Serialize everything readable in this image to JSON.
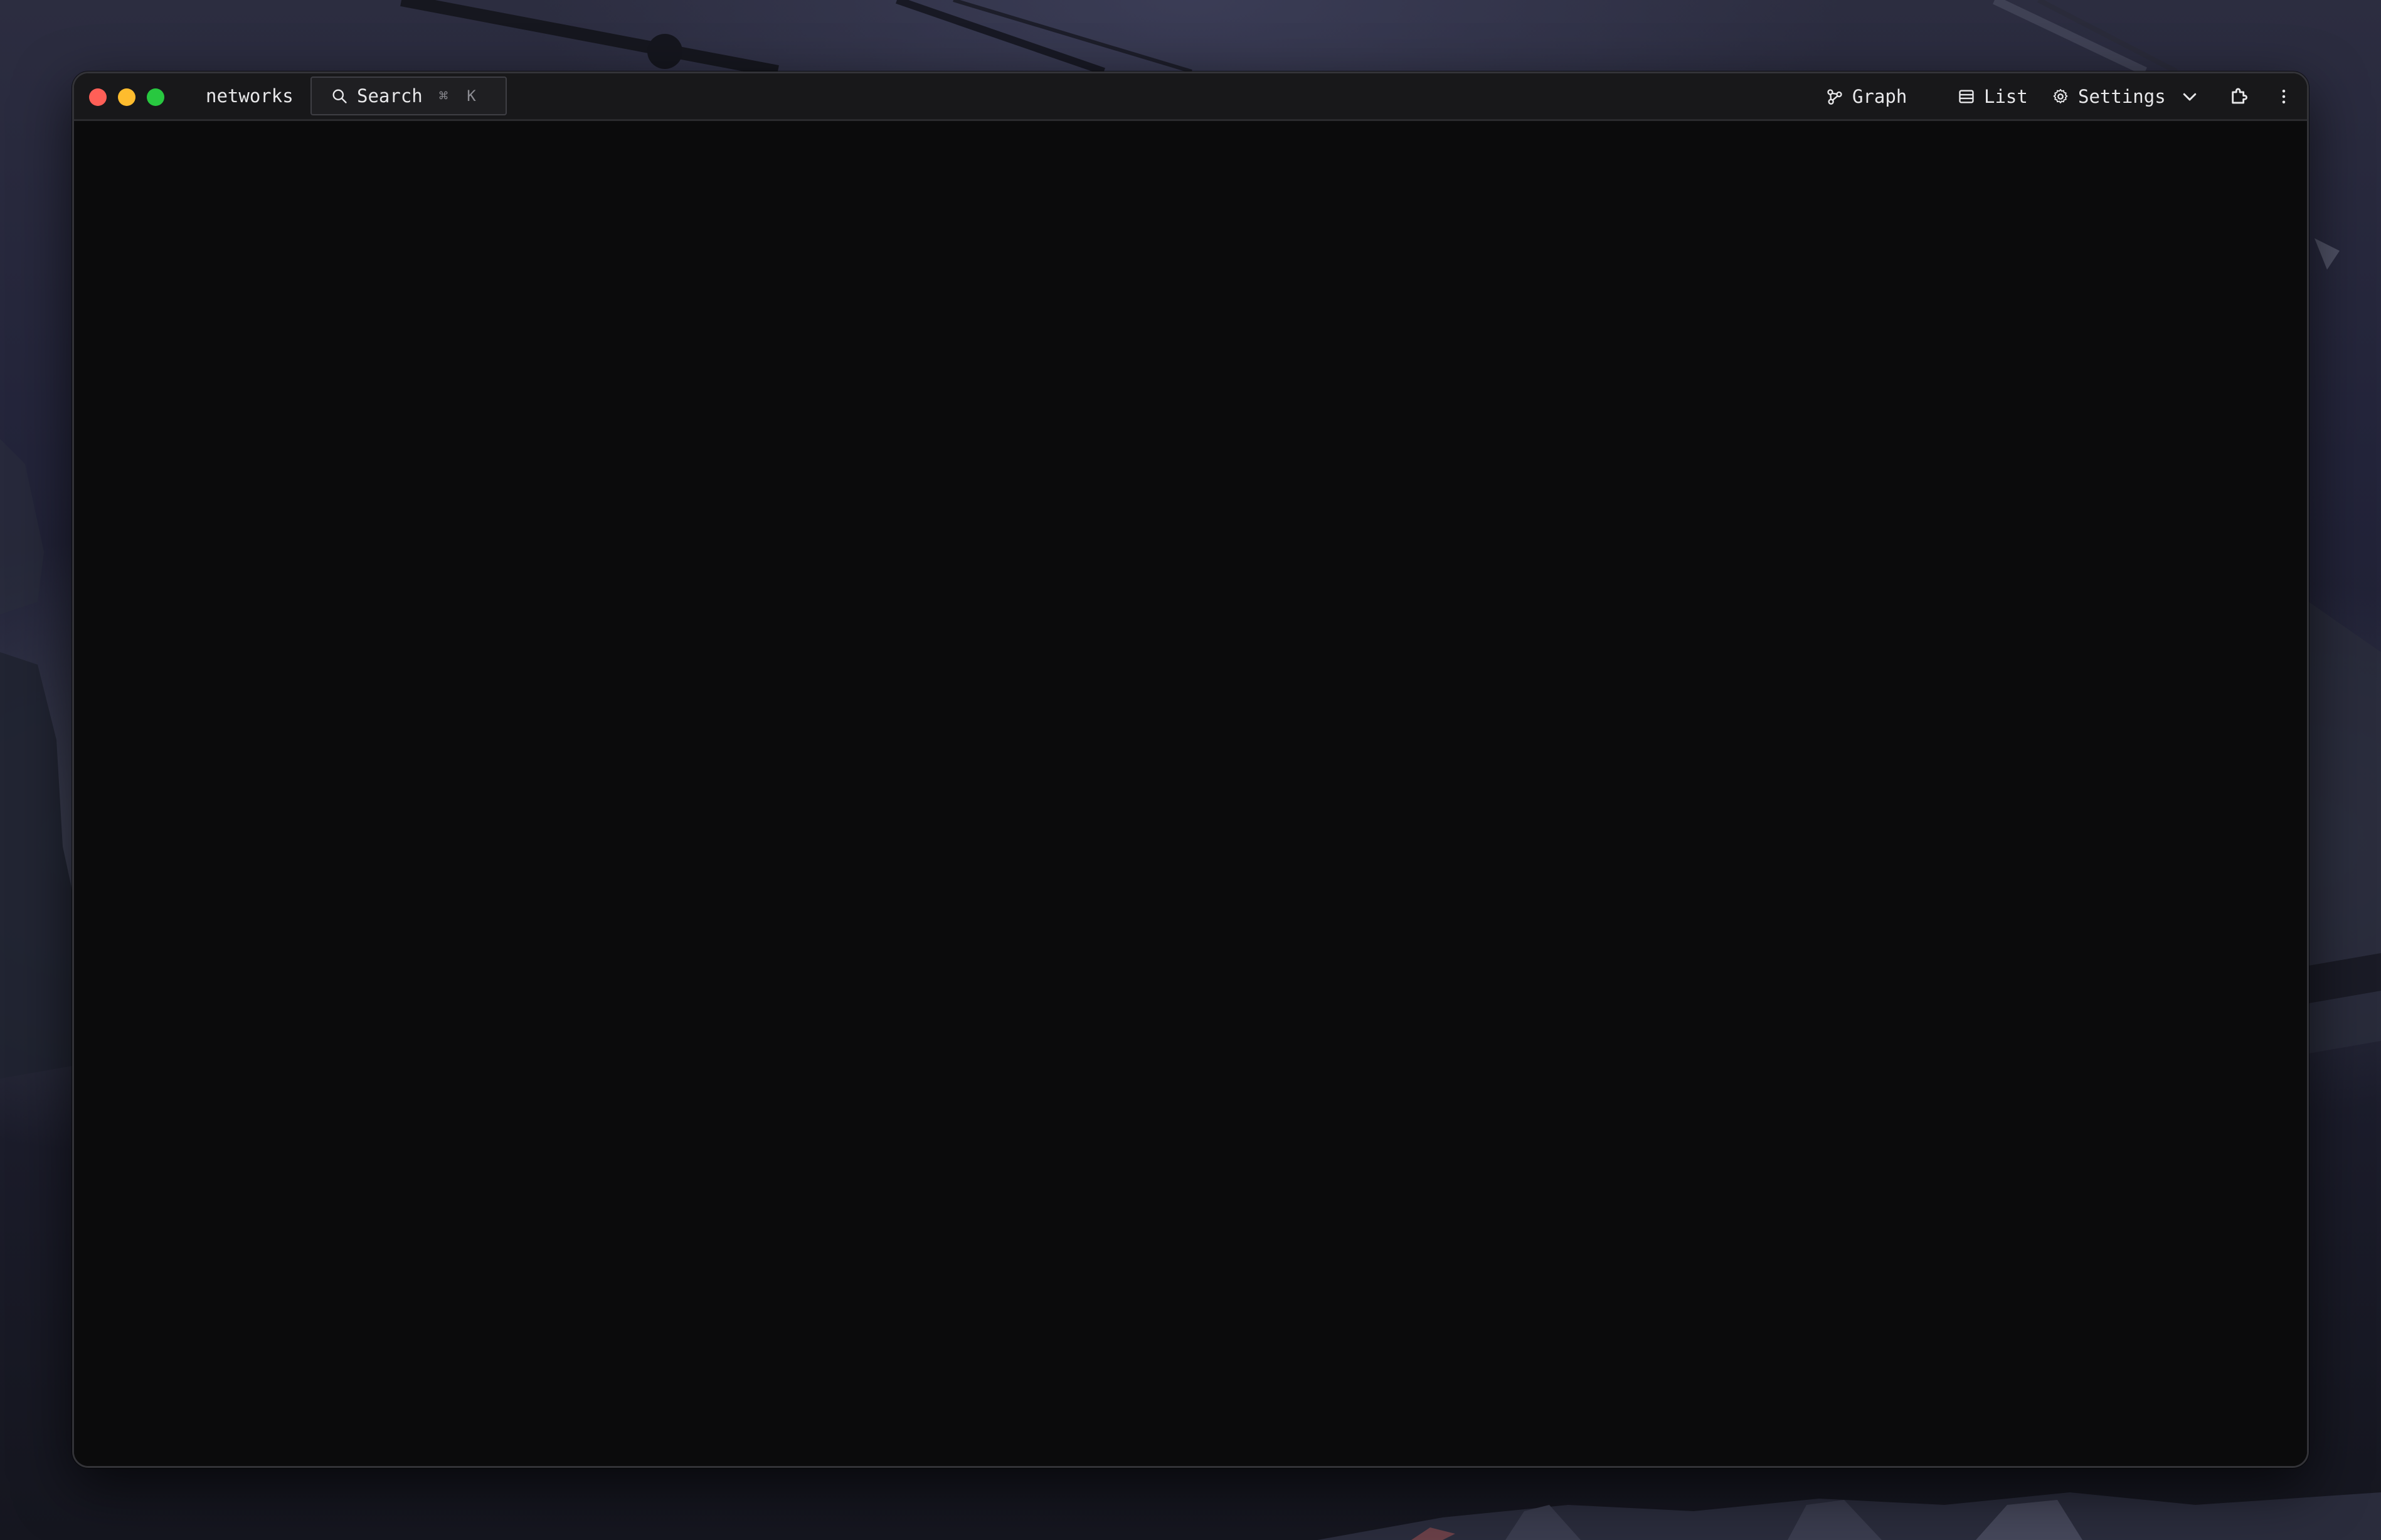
{
  "window": {
    "app_title": "networks"
  },
  "search": {
    "label": "Search",
    "shortcut_modifier": "⌘",
    "shortcut_key": "K"
  },
  "toolbar": {
    "graph_label": "Graph",
    "list_label": "List",
    "settings_label": "Settings"
  },
  "icons": {
    "search": "search-icon",
    "graph": "graph-icon",
    "list": "list-icon",
    "settings": "gear-icon",
    "dropdown": "chevron-down-icon",
    "extensions": "puzzle-icon",
    "more": "more-vertical-icon"
  },
  "colors": {
    "window_background": "#0b0b0c",
    "titlebar_background": "#18181a",
    "text": "#e8e8ea",
    "traffic_close": "#ff5f57",
    "traffic_minimize": "#febc2e",
    "traffic_maximize": "#28c840"
  }
}
